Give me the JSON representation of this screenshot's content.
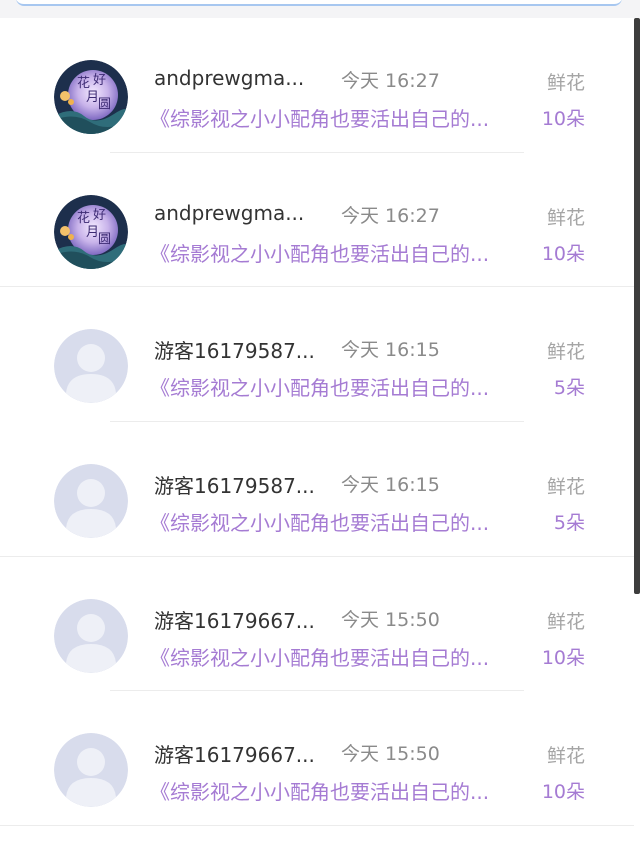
{
  "gifts": [
    {
      "user_name": "andprewgma...",
      "time": "今天 16:27",
      "gift_label": "鲜花",
      "book_title": "《综影视之小小配角也要活出自己的...",
      "gift_count": "10朵",
      "avatar_type": "moon",
      "avatar_text": "花好月圆"
    },
    {
      "user_name": "andprewgma...",
      "time": "今天 16:27",
      "gift_label": "鲜花",
      "book_title": "《综影视之小小配角也要活出自己的...",
      "gift_count": "10朵",
      "avatar_type": "moon",
      "avatar_text": "花好月圆"
    },
    {
      "user_name": "游客16179587...",
      "time": "今天 16:15",
      "gift_label": "鲜花",
      "book_title": "《综影视之小小配角也要活出自己的...",
      "gift_count": "5朵",
      "avatar_type": "default",
      "avatar_text": ""
    },
    {
      "user_name": "游客16179587...",
      "time": "今天 16:15",
      "gift_label": "鲜花",
      "book_title": "《综影视之小小配角也要活出自己的...",
      "gift_count": "5朵",
      "avatar_type": "default",
      "avatar_text": ""
    },
    {
      "user_name": "游客16179667...",
      "time": "今天 15:50",
      "gift_label": "鲜花",
      "book_title": "《综影视之小小配角也要活出自己的...",
      "gift_count": "10朵",
      "avatar_type": "default",
      "avatar_text": ""
    },
    {
      "user_name": "游客16179667...",
      "time": "今天 15:50",
      "gift_label": "鲜花",
      "book_title": "《综影视之小小配角也要活出自己的...",
      "gift_count": "10朵",
      "avatar_type": "default",
      "avatar_text": ""
    }
  ],
  "colors": {
    "book_title": "#a57bd3",
    "user_name": "#333333",
    "time": "#8a8a8a",
    "gift_label": "#a5a5a5",
    "default_avatar_bg": "#d8dcec"
  }
}
